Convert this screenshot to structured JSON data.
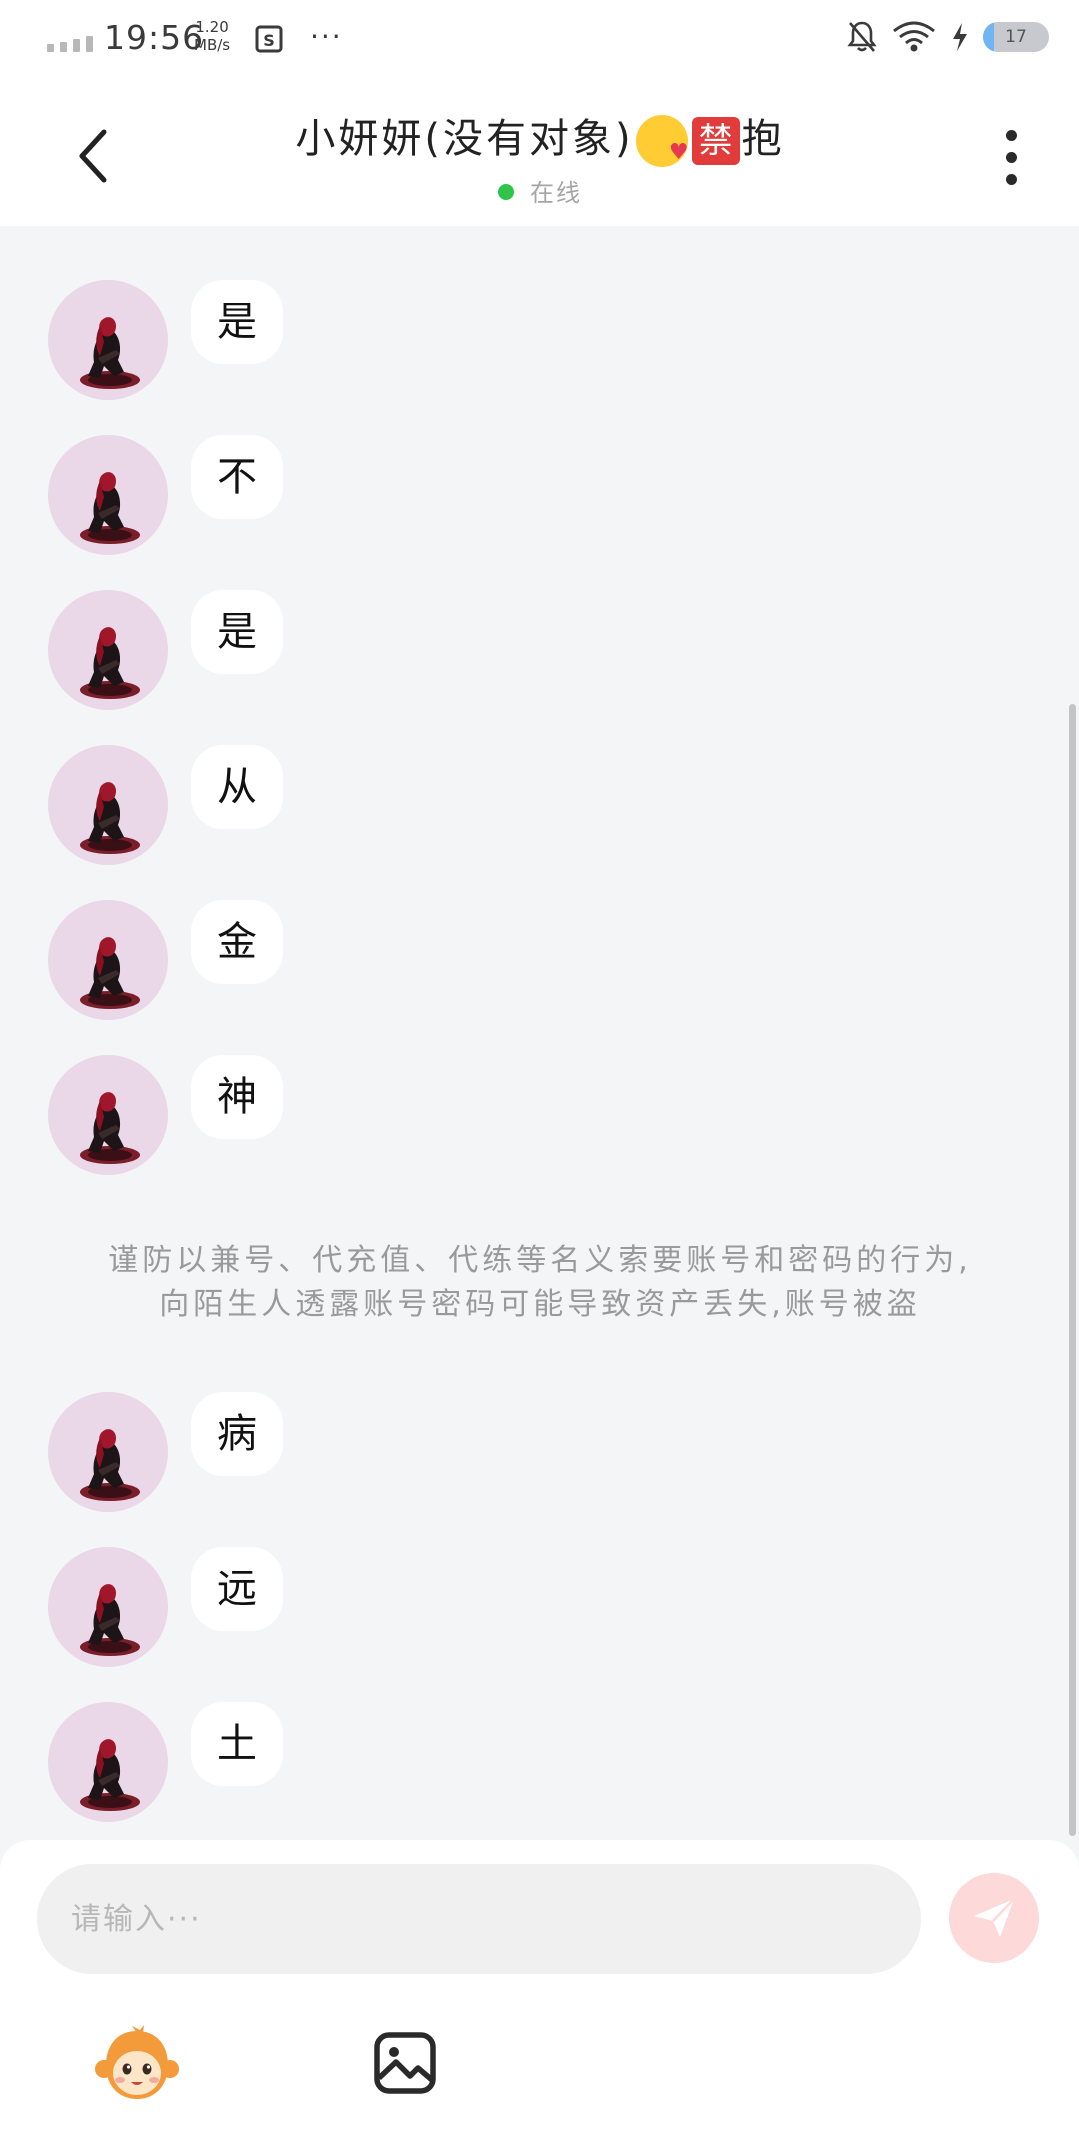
{
  "status_bar": {
    "time": "19:56",
    "speed_value": "1.20",
    "speed_unit": "MB/s",
    "more": "···",
    "battery": "17",
    "battery_level": 0.17
  },
  "header": {
    "title_text": "小妍妍(没有对象)",
    "title_ban": "禁",
    "title_tail": "抱",
    "status": "在线",
    "status_color": "#2fc44a"
  },
  "messages": [
    {
      "text": "是"
    },
    {
      "text": "不"
    },
    {
      "text": "是"
    },
    {
      "text": "从"
    },
    {
      "text": "金"
    },
    {
      "text": "神"
    },
    {
      "text": "病"
    },
    {
      "text": "远"
    },
    {
      "text": "土"
    }
  ],
  "notice": {
    "line1": "谨防以兼号、代充值、代练等名义索要账号和密码的行为,",
    "line2": "向陌生人透露账号密码可能导致资产丢失,账号被盗"
  },
  "composer": {
    "placeholder": "请输入···",
    "send_color": "#fdd9d9"
  },
  "icons": {
    "back": "back-arrow-icon",
    "more": "more-vertical-icon",
    "send": "paper-plane-icon",
    "emoji": "monkey-emoji-icon",
    "image": "image-icon"
  }
}
